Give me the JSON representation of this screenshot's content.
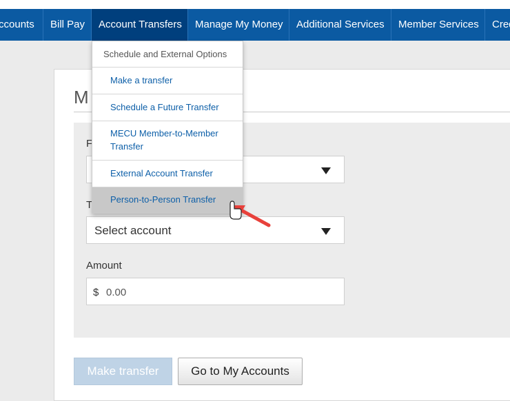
{
  "nav": {
    "items": [
      {
        "label": "Accounts"
      },
      {
        "label": "Bill Pay"
      },
      {
        "label": "Account Transfers"
      },
      {
        "label": "Manage My Money"
      },
      {
        "label": "Additional Services"
      },
      {
        "label": "Member Services"
      },
      {
        "label": "Cred"
      }
    ],
    "active_item": "Account Transfers"
  },
  "dropdown": {
    "header": "Schedule and External Options",
    "items": [
      {
        "label": "Make a transfer"
      },
      {
        "label": "Schedule a Future Transfer"
      },
      {
        "label": "MECU Member-to-Member Transfer"
      },
      {
        "label": "External Account Transfer"
      },
      {
        "label": "Person-to-Person Transfer"
      }
    ],
    "hovered_item": "Person-to-Person Transfer"
  },
  "page": {
    "title_visible": "M",
    "from_label_visible": "F",
    "to_label_visible": "T",
    "to_select_value": "Select account",
    "amount_label": "Amount",
    "amount_prefix": "$",
    "amount_placeholder": "0.00"
  },
  "buttons": {
    "make_transfer": "Make transfer",
    "go_to_accounts": "Go to My Accounts"
  },
  "colors": {
    "nav_bg": "#0b5aa2",
    "nav_active_bg": "#003f7d",
    "link": "#0d5fa8",
    "arrow": "#e8413b",
    "disabled_button": "#bfd3e6"
  },
  "icons": {
    "select_caret": "caret-down-icon",
    "cursor": "hand-pointer-icon",
    "annotation": "red-arrow-icon"
  }
}
